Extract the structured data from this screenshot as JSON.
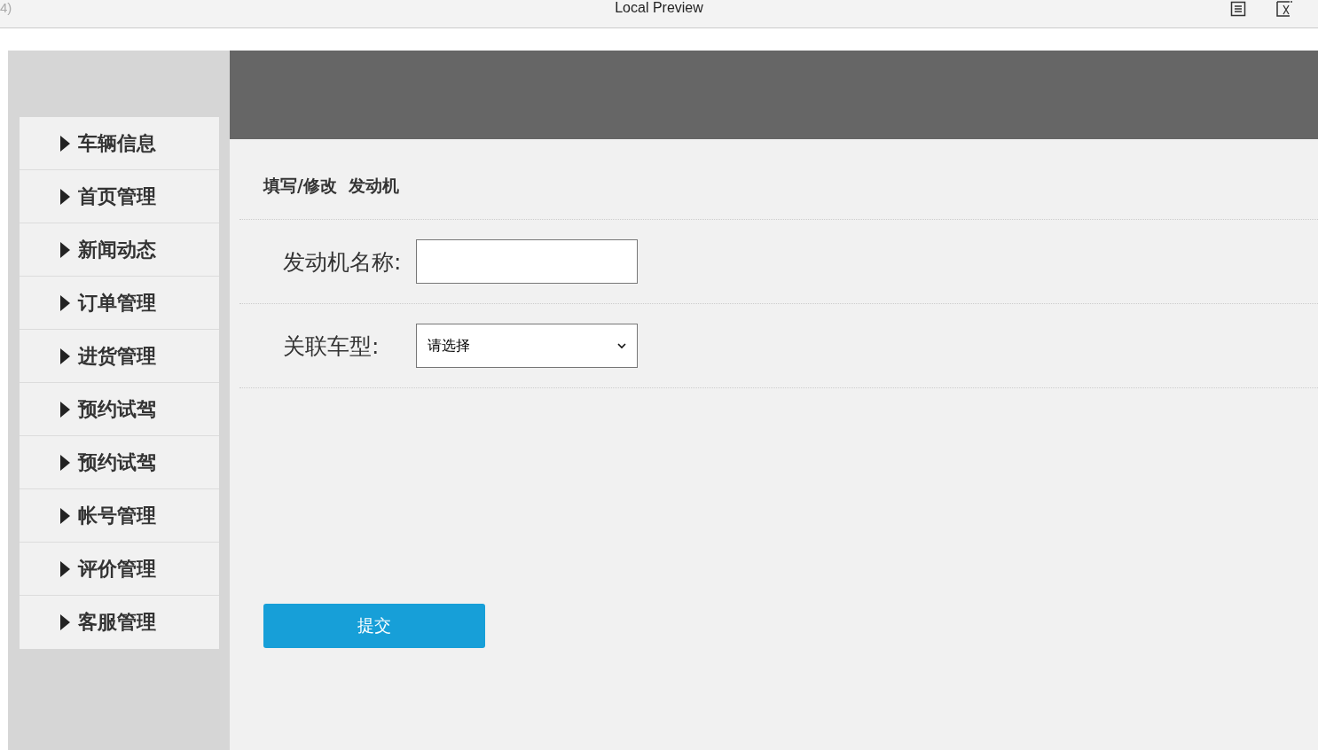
{
  "window": {
    "title": "Local Preview",
    "corner_text": "4)"
  },
  "sidebar": {
    "items": [
      {
        "label": "车辆信息"
      },
      {
        "label": "首页管理"
      },
      {
        "label": "新闻动态"
      },
      {
        "label": "订单管理"
      },
      {
        "label": "进货管理"
      },
      {
        "label": "预约试驾"
      },
      {
        "label": "预约试驾"
      },
      {
        "label": "帐号管理"
      },
      {
        "label": "评价管理"
      },
      {
        "label": "客服管理"
      }
    ]
  },
  "form": {
    "title": "填写/修改  发动机",
    "fields": [
      {
        "kind": "text",
        "label": "发动机名称:"
      },
      {
        "kind": "select",
        "label": "关联车型:",
        "value": "请选择"
      }
    ],
    "submit": "提交"
  }
}
